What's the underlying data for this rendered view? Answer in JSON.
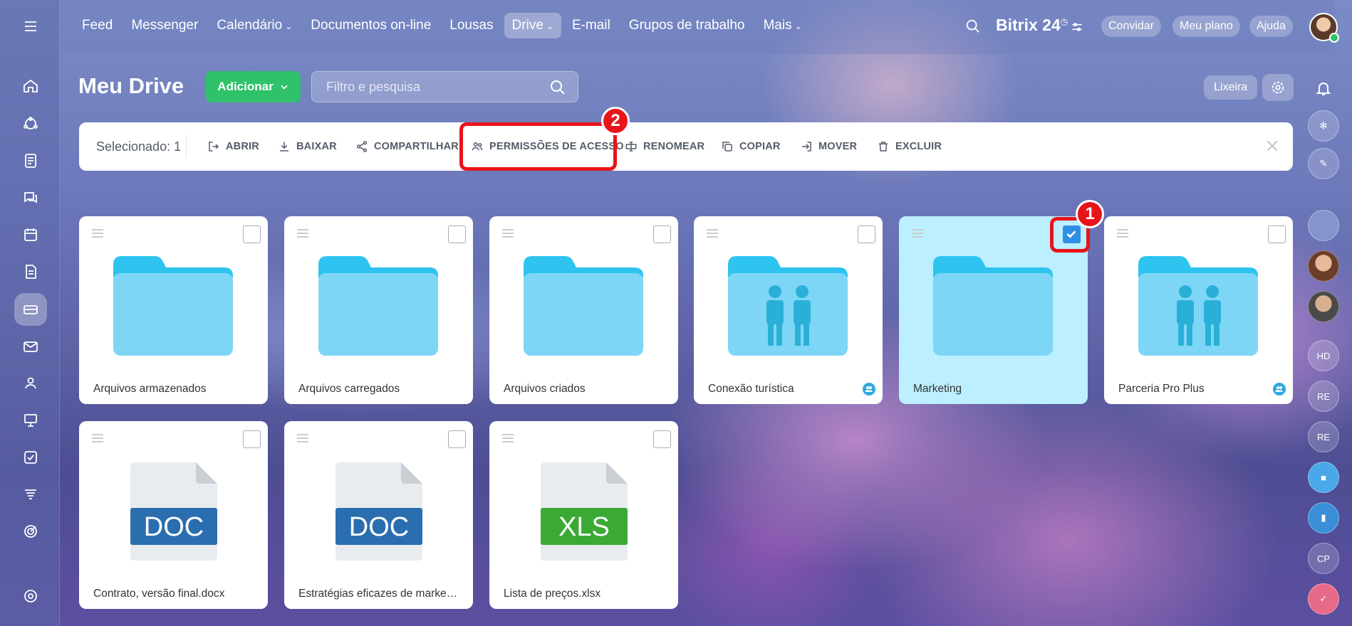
{
  "nav": {
    "items": [
      {
        "label": "Feed",
        "caret": false,
        "active": false
      },
      {
        "label": "Messenger",
        "caret": false,
        "active": false
      },
      {
        "label": "Calendário",
        "caret": true,
        "active": false
      },
      {
        "label": "Documentos on-line",
        "caret": false,
        "active": false
      },
      {
        "label": "Lousas",
        "caret": false,
        "active": false
      },
      {
        "label": "Drive",
        "caret": true,
        "active": true
      },
      {
        "label": "E-mail",
        "caret": false,
        "active": false
      },
      {
        "label": "Grupos de trabalho",
        "caret": false,
        "active": false
      },
      {
        "label": "Mais",
        "caret": true,
        "active": false
      }
    ],
    "brand": "Bitrix 24",
    "invite": "Convidar",
    "plan": "Meu plano",
    "help": "Ajuda"
  },
  "header": {
    "title": "Meu Drive",
    "add_label": "Adicionar",
    "search_placeholder": "Filtro e pesquisa",
    "trash_label": "Lixeira"
  },
  "actionbar": {
    "selected_label": "Selecionado: 1",
    "actions": {
      "open": "ABRIR",
      "download": "BAIXAR",
      "share": "COMPARTILHAR",
      "permissions": "PERMISSÕES DE ACESSO",
      "rename": "RENOMEAR",
      "copy": "COPIAR",
      "move": "MOVER",
      "delete": "EXCLUIR"
    }
  },
  "annotations": {
    "marker_1": "1",
    "marker_2": "2",
    "color": "#e8141a"
  },
  "right_rail": {
    "initials": [
      "HD",
      "RE",
      "RE",
      "CP"
    ]
  },
  "items": [
    {
      "name": "Arquivos armazenados",
      "type": "folder",
      "shared": false,
      "selected": false
    },
    {
      "name": "Arquivos carregados",
      "type": "folder",
      "shared": false,
      "selected": false
    },
    {
      "name": "Arquivos criados",
      "type": "folder",
      "shared": false,
      "selected": false
    },
    {
      "name": "Conexão turística",
      "type": "folder-group",
      "shared": true,
      "selected": false
    },
    {
      "name": "Marketing",
      "type": "folder",
      "shared": false,
      "selected": true
    },
    {
      "name": "Parceria Pro Plus",
      "type": "folder-group",
      "shared": true,
      "selected": false
    },
    {
      "name": "Contrato, versão final.docx",
      "type": "doc",
      "ext": "DOC",
      "ext_color": "#2b6eb0",
      "shared": false,
      "selected": false
    },
    {
      "name": "Estratégias eficazes de marketing.docx",
      "type": "doc",
      "ext": "DOC",
      "ext_color": "#2b6eb0",
      "shared": false,
      "selected": false
    },
    {
      "name": "Lista de preços.xlsx",
      "type": "xls",
      "ext": "XLS",
      "ext_color": "#3aaa35",
      "shared": false,
      "selected": false
    }
  ],
  "colors": {
    "accent_green": "#2fc26a",
    "folder_light": "#7dd6f6",
    "folder_dark": "#2fc3ef",
    "check_blue": "#2f8fe6"
  }
}
